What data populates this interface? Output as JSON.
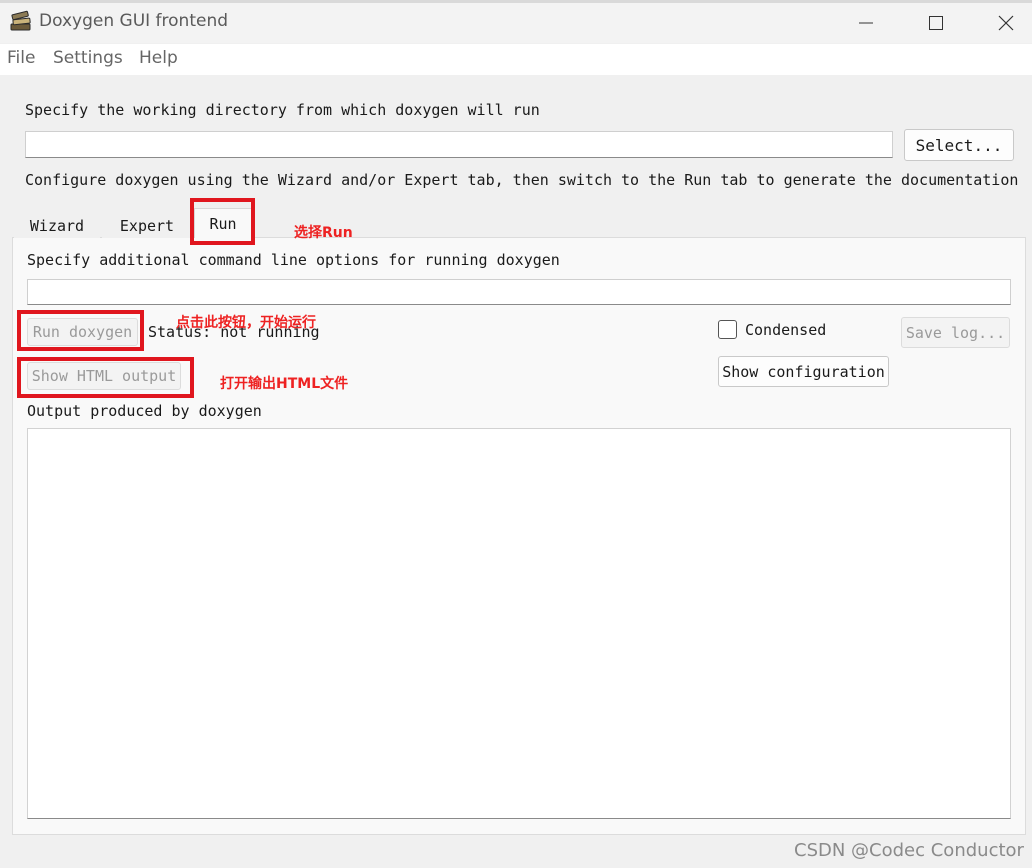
{
  "window": {
    "title": "Doxygen GUI frontend"
  },
  "menu": {
    "items": [
      "File",
      "Settings",
      "Help"
    ]
  },
  "working_dir": {
    "label": "Specify the working directory from which doxygen will run",
    "value": "",
    "select_button": "Select..."
  },
  "configure_hint": "Configure doxygen using the Wizard and/or Expert tab, then switch to the Run tab to generate the documentation",
  "tabs": [
    {
      "label": "Wizard",
      "active": false
    },
    {
      "label": "Expert",
      "active": false
    },
    {
      "label": "Run",
      "active": true
    }
  ],
  "run_tab": {
    "options_label": "Specify additional command line options for running doxygen",
    "options_value": "",
    "run_button": "Run doxygen",
    "status": "Status: not running",
    "condensed_label": "Condensed",
    "condensed_checked": false,
    "save_log_button": "Save log...",
    "show_html_button": "Show HTML output",
    "show_config_button": "Show configuration",
    "output_label": "Output produced by doxygen",
    "output_text": ""
  },
  "annotations": {
    "select_run": "选择Run",
    "click_run": "点击此按钮，开始运行",
    "open_html": "打开输出HTML文件"
  },
  "watermark": "CSDN @Codec Conductor",
  "colors": {
    "annotation_red": "#e0161e",
    "annotation_text": "#ee2222"
  },
  "icons": {
    "app": "doxygen-books-icon",
    "minimize": "minimize-icon",
    "maximize": "maximize-icon",
    "close": "close-icon"
  }
}
